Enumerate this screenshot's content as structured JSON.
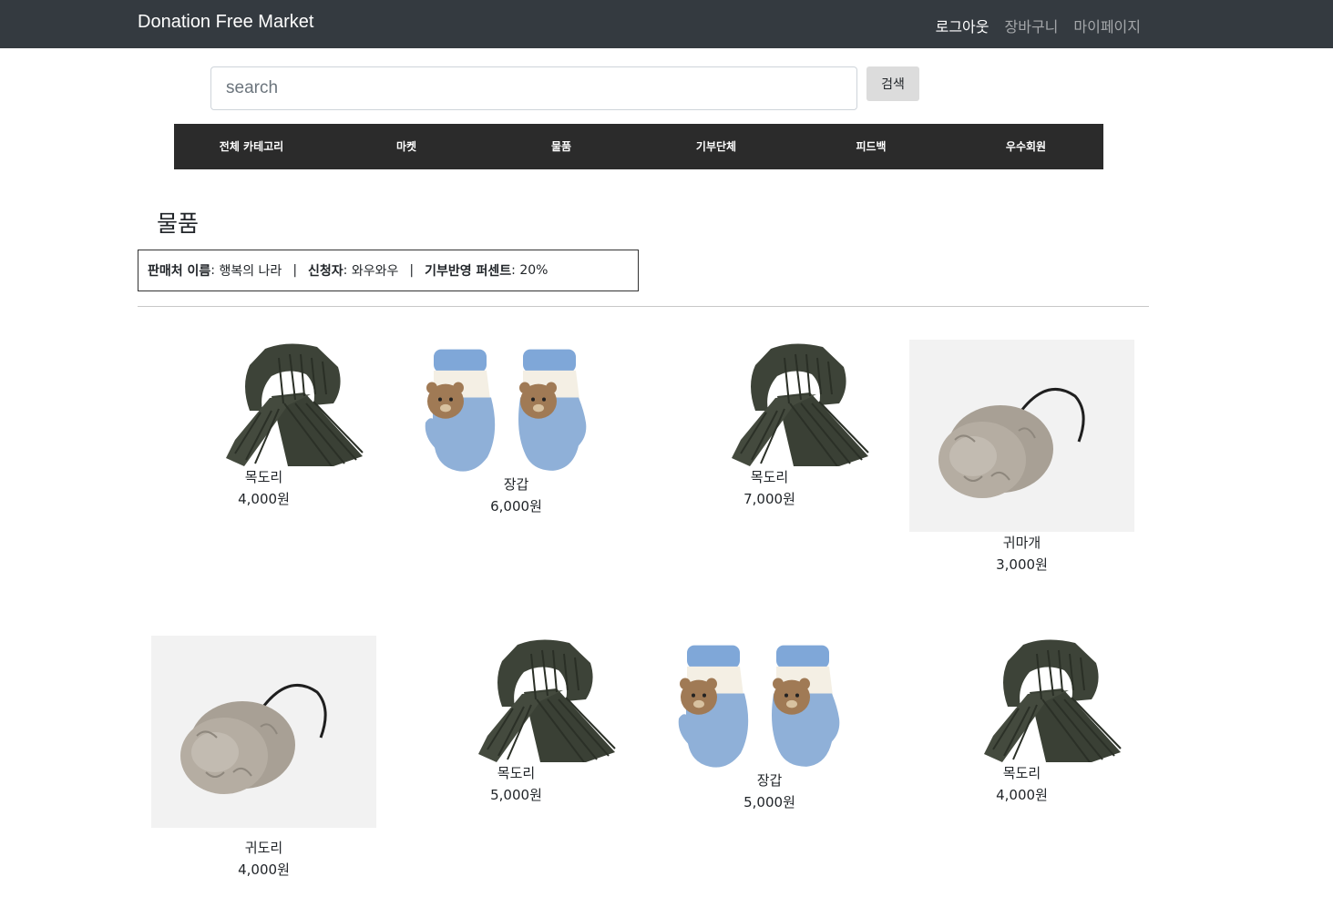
{
  "navbar": {
    "brand": "Donation Free Market",
    "links": [
      {
        "label": "로그아웃",
        "active": true
      },
      {
        "label": "장바구니",
        "active": false
      },
      {
        "label": "마이페이지",
        "active": false
      }
    ]
  },
  "search": {
    "placeholder": "search",
    "button_label": "검색"
  },
  "categories": [
    "전체 카테고리",
    "마켓",
    "물품",
    "기부단체",
    "피드백",
    "우수회원"
  ],
  "page_title": "물품",
  "info": {
    "seller_label": "판매처 이름",
    "seller_value": "행복의 나라",
    "separator": "|",
    "applicant_label": "신청자",
    "applicant_value": "와우와우",
    "percent_label": "기부반영 퍼센트",
    "percent_value": "20%"
  },
  "products": [
    {
      "name": "목도리",
      "price": "4,000원",
      "icon": "scarf-image"
    },
    {
      "name": "장갑",
      "price": "6,000원",
      "icon": "mittens-image"
    },
    {
      "name": "목도리",
      "price": "7,000원",
      "icon": "scarf-image"
    },
    {
      "name": "귀마개",
      "price": "3,000원",
      "icon": "earmuff-image"
    },
    {
      "name": "귀도리",
      "price": "4,000원",
      "icon": "earmuff-image"
    },
    {
      "name": "목도리",
      "price": "5,000원",
      "icon": "scarf-image"
    },
    {
      "name": "장갑",
      "price": "5,000원",
      "icon": "mittens-image"
    },
    {
      "name": "목도리",
      "price": "4,000원",
      "icon": "scarf-image"
    }
  ],
  "colors": {
    "navbar_bg": "#343a40",
    "category_bar_bg": "#2b2b2b",
    "scarf": "#3d4338",
    "mitten_blue": "#8fb0d8",
    "earmuff_fur": "#a8a095"
  }
}
